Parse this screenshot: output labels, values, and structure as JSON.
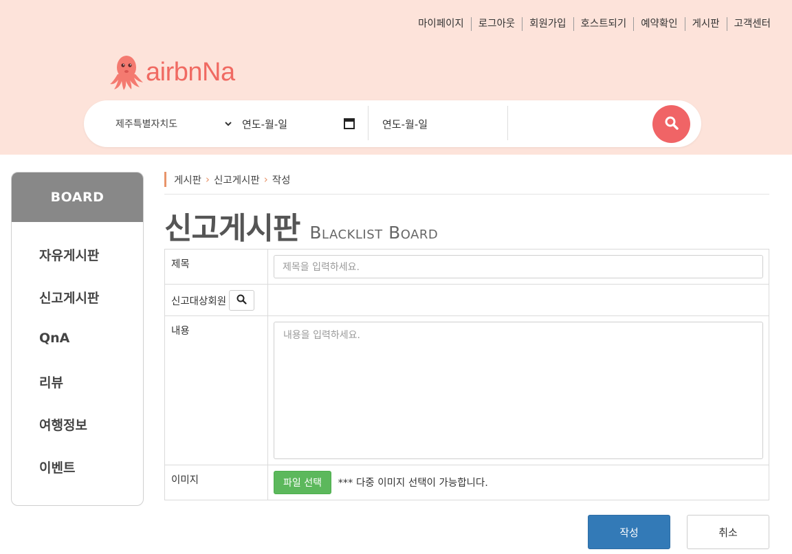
{
  "topnav": [
    "마이페이지",
    "로그아웃",
    "회원가입",
    "호스트되기",
    "예약확인",
    "게시판",
    "고객센터"
  ],
  "logo": {
    "text": "airbnNa",
    "icon": "octopus-icon"
  },
  "search": {
    "region": "제주특별자치도",
    "checkin": "연도-월-일",
    "checkout": "연도-월-일",
    "button_icon": "search-icon"
  },
  "sidebar": {
    "heading": "BOARD",
    "items": [
      {
        "label": "자유게시판"
      },
      {
        "label": "신고게시판"
      },
      {
        "label": "QnA"
      },
      {
        "label": "리뷰"
      },
      {
        "label": "여행정보"
      },
      {
        "label": "이벤트"
      }
    ]
  },
  "breadcrumb": [
    "게시판",
    "신고게시판",
    "작성"
  ],
  "page": {
    "title_kr": "신고게시판",
    "title_en": "Blacklist Board"
  },
  "form": {
    "title_label": "제목",
    "title_placeholder": "제목을 입력하세요.",
    "member_label": "신고대상회원",
    "content_label": "내용",
    "content_placeholder": "내용을 입력하세요.",
    "image_label": "이미지",
    "file_button": "파일 선택",
    "file_note": "*** 다중 이미지 선택이 가능합니다."
  },
  "actions": {
    "submit": "작성",
    "cancel": "취소"
  },
  "colors": {
    "header_bg": "#fde3da",
    "accent": "#f06466",
    "primary": "#337ab7",
    "success": "#5cb85c"
  }
}
